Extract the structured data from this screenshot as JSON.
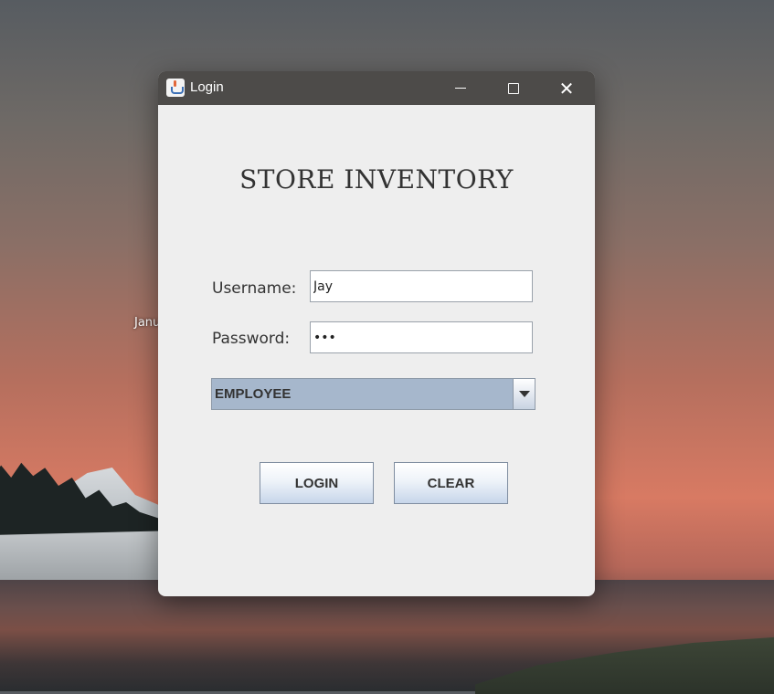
{
  "desktop": {
    "label": "Janu"
  },
  "window": {
    "title": "Login",
    "controls": {
      "minimize": "minimize",
      "maximize": "maximize",
      "close": "✕"
    }
  },
  "form": {
    "heading": "STORE INVENTORY",
    "username_label": "Username:",
    "username_value": "Jay",
    "password_label": "Password:",
    "password_value": "•••",
    "role_selected": "EMPLOYEE",
    "login_label": "LOGIN",
    "clear_label": "CLEAR"
  }
}
